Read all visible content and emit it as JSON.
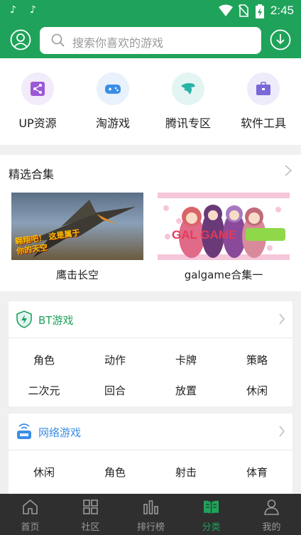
{
  "status_bar": {
    "time": "2:45"
  },
  "search": {
    "placeholder": "搜索你喜欢的游戏"
  },
  "quick_links": [
    {
      "label": "UP资源",
      "icon": "share-icon",
      "color": "#9b59d6"
    },
    {
      "label": "淘游戏",
      "icon": "gamepad-icon",
      "color": "#3a8ee6"
    },
    {
      "label": "腾讯专区",
      "icon": "tencent-icon",
      "color": "#28b3a5"
    },
    {
      "label": "软件工具",
      "icon": "toolbox-icon",
      "color": "#7b68d8"
    }
  ],
  "curated": {
    "title": "精选合集",
    "cards": [
      {
        "caption": "鹰击长空",
        "image_text": "翱翔吧！ 这是属于你的天空"
      },
      {
        "caption": "galgame合集一",
        "image_text": "GAL GAME"
      }
    ]
  },
  "genres": [
    {
      "title": "BT游戏",
      "icon": "bt-shield-icon",
      "tags": [
        "角色",
        "动作",
        "卡牌",
        "策略",
        "二次元",
        "回合",
        "放置",
        "休闲"
      ]
    },
    {
      "title": "网络游戏",
      "icon": "network-icon",
      "tags": [
        "休闲",
        "角色",
        "射击",
        "体育"
      ]
    }
  ],
  "bottom_nav": [
    {
      "label": "首页",
      "icon": "home-icon"
    },
    {
      "label": "社区",
      "icon": "community-icon"
    },
    {
      "label": "排行榜",
      "icon": "ranking-icon"
    },
    {
      "label": "分类",
      "icon": "category-icon",
      "active": true
    },
    {
      "label": "我的",
      "icon": "profile-icon"
    }
  ],
  "colors": {
    "brand": "#1fa35a",
    "nav_bg": "#2f2f2f"
  }
}
